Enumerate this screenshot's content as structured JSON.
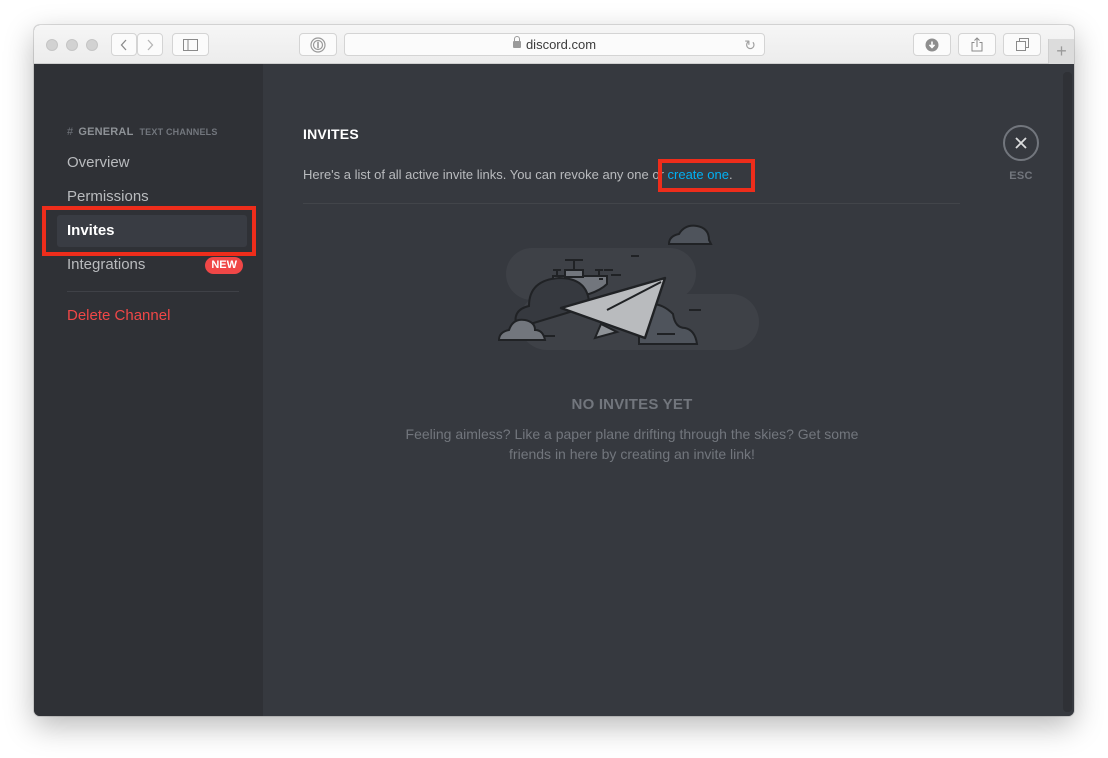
{
  "browser": {
    "url": "discord.com",
    "toolbar_icons": [
      "back-icon",
      "forward-icon",
      "sidebar-icon",
      "password-manager-icon",
      "reload-icon",
      "download-icon",
      "share-icon",
      "tabs-icon",
      "new-tab-icon"
    ]
  },
  "sidebar": {
    "channel_prefix": "#",
    "channel_name": "GENERAL",
    "category": "TEXT CHANNELS",
    "items": [
      {
        "label": "Overview",
        "active": false
      },
      {
        "label": "Permissions",
        "active": false
      },
      {
        "label": "Invites",
        "active": true
      },
      {
        "label": "Integrations",
        "active": false,
        "badge": "NEW"
      }
    ],
    "delete_label": "Delete Channel"
  },
  "main": {
    "title": "INVITES",
    "description_before": "Here's a list of all active invite links. You can revoke any one or ",
    "description_link": "create one",
    "description_after": ".",
    "close_label": "ESC",
    "empty_state": {
      "title": "NO INVITES YET",
      "description": "Feeling aimless? Like a paper plane drifting through the skies? Get some friends in here by creating an invite link!"
    }
  },
  "annotations": {
    "highlight_color": "#ee2d1b",
    "highlighted": [
      "sidebar-item-invites",
      "create-invite-link"
    ]
  },
  "colors": {
    "sidebar_bg": "#2f3136",
    "content_bg": "#36393f",
    "link": "#00b0f4",
    "danger": "#f04747"
  }
}
